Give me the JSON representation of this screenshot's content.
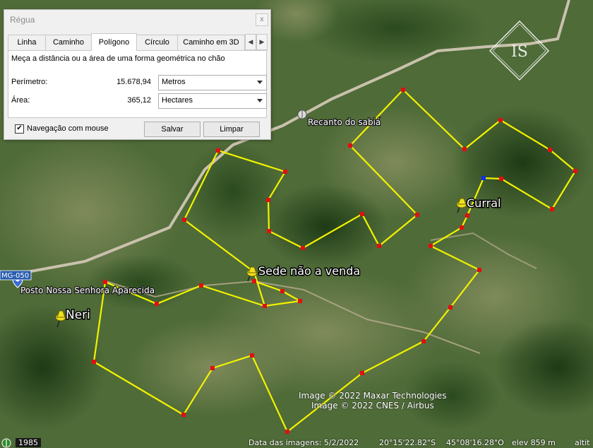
{
  "ruler": {
    "title": "Régua",
    "close_glyph": "x",
    "tabs": [
      {
        "label": "Linha",
        "active": false
      },
      {
        "label": "Caminho",
        "active": false
      },
      {
        "label": "Polígono",
        "active": true
      },
      {
        "label": "Círculo",
        "active": false
      },
      {
        "label": "Caminho em 3D",
        "active": false
      }
    ],
    "description": "Meça a distância ou a área de uma forma geométrica no chão",
    "perimeter_label": "Perímetro:",
    "perimeter_value": "15.678,94",
    "perimeter_unit": "Metros",
    "area_label": "Área:",
    "area_value": "365,12",
    "area_unit": "Hectares",
    "mouse_nav_label": "Navegação com mouse",
    "mouse_nav_checked": true,
    "save_label": "Salvar",
    "clear_label": "Limpar"
  },
  "map": {
    "placemarks": [
      {
        "id": "neri",
        "label": "Neri"
      },
      {
        "id": "sede",
        "label": "Sede não a venda"
      },
      {
        "id": "curral",
        "label": "Curral"
      }
    ],
    "pois": [
      {
        "id": "recanto",
        "label": "Recanto do sabiá"
      },
      {
        "id": "posto",
        "label": "Posto Nossa Senhora Aparecida"
      }
    ],
    "road_shield": "MG-050",
    "logo_text": "IS",
    "credits": [
      "Image © 2022 Maxar Technologies",
      "Image © 2022 CNES / Airbus"
    ],
    "colors": {
      "polygon_line": "#f2f200",
      "vertex": "#e01010",
      "selected_vertex": "#1030e0",
      "pin": "#f0e020"
    }
  },
  "status": {
    "year": "1985",
    "imagery_date": "Data das imagens: 5/2/2022",
    "lat": "20°15'22.82\"S",
    "lon": "45°08'16.28\"O",
    "elev": "elev  859 m",
    "alt": "altit"
  }
}
